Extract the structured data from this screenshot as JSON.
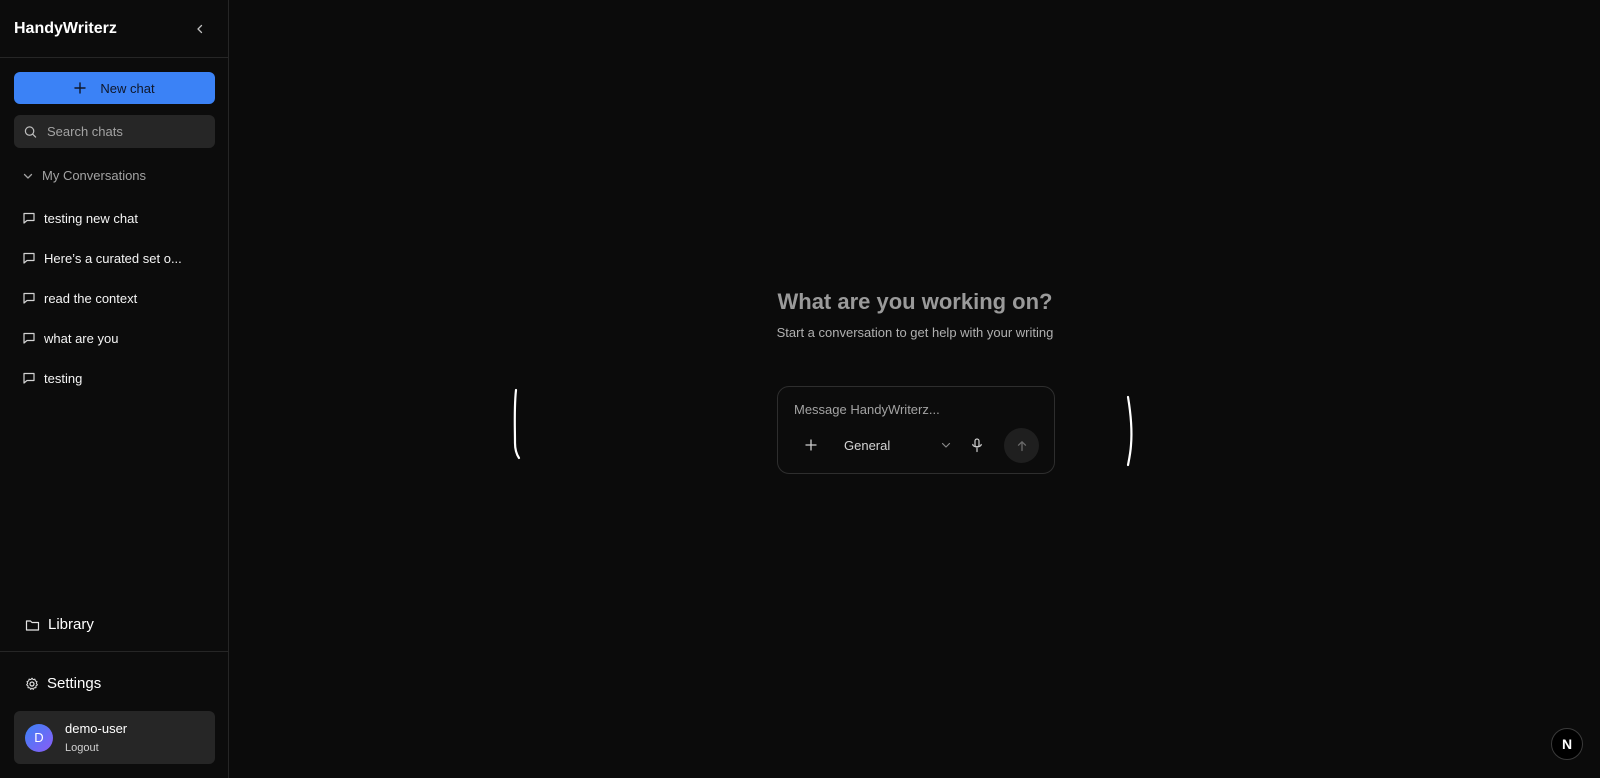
{
  "sidebar": {
    "app_title": "HandyWriterz",
    "new_chat_label": "New chat",
    "search_placeholder": "Search chats",
    "section_title": "My Conversations",
    "conversations": [
      {
        "title": "testing new chat"
      },
      {
        "title": "Here’s a curated set o..."
      },
      {
        "title": "read the context"
      },
      {
        "title": "what are you"
      },
      {
        "title": "testing"
      }
    ],
    "library_label": "Library",
    "settings_label": "Settings",
    "user": {
      "initial": "D",
      "name": "demo-user",
      "logout_label": "Logout"
    }
  },
  "main": {
    "title": "What are you working on?",
    "subtitle": "Start a conversation to get help with your writing",
    "composer": {
      "placeholder": "Message HandyWriterz...",
      "mode": "General"
    },
    "badge": "N"
  },
  "colors": {
    "accent": "#3b82f6",
    "background": "#0b0b0b",
    "panel": "#262626"
  },
  "icons": [
    "chevron-left-icon",
    "plus-icon",
    "search-icon",
    "chevron-down-icon",
    "chat-bubble-icon",
    "folder-icon",
    "gear-icon",
    "mic-icon",
    "arrow-up-icon"
  ]
}
